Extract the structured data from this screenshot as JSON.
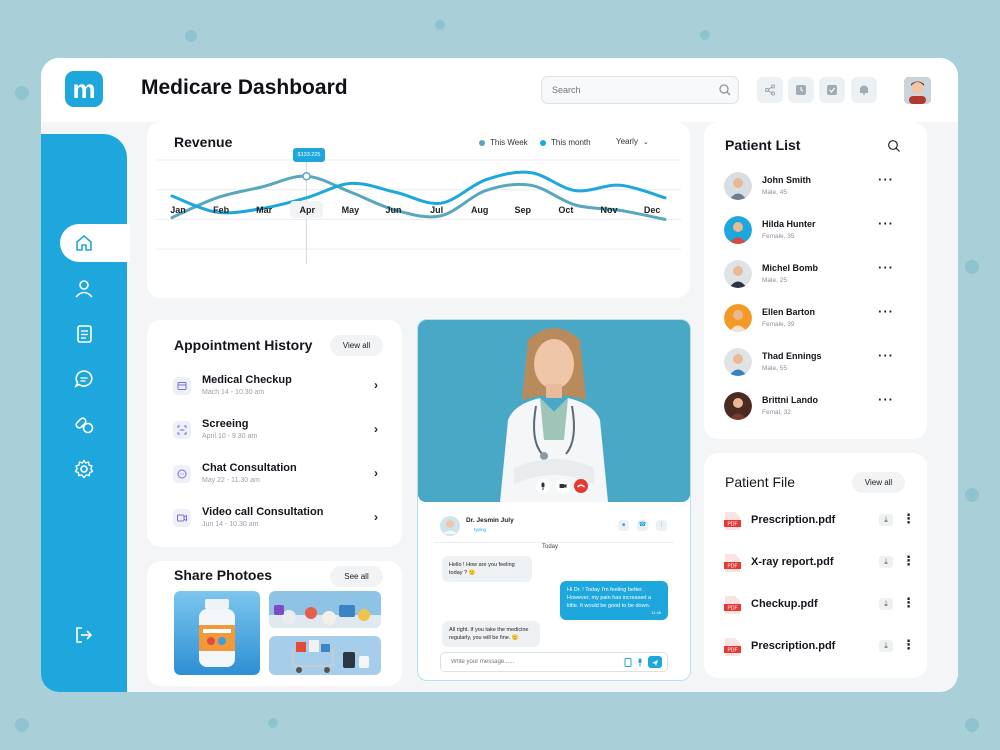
{
  "header": {
    "logo_letter": "m",
    "title": "Medicare Dashboard",
    "search_placeholder": "Search"
  },
  "revenue": {
    "title": "Revenue",
    "legend": [
      {
        "label": "This Week",
        "color": "#58a7bd"
      },
      {
        "label": "This month",
        "color": "#1ea7dd"
      }
    ],
    "period": "Yearly",
    "tooltip": "$133.225",
    "selected_month": "Apr"
  },
  "chart_data": {
    "type": "line",
    "categories": [
      "Jan",
      "Feb",
      "Mar",
      "Apr",
      "May",
      "Jun",
      "Jul",
      "Aug",
      "Sep",
      "Oct",
      "Nov",
      "Dec"
    ],
    "series": [
      {
        "name": "This Week",
        "color": "#58a7bd",
        "values": [
          36,
          58,
          70,
          82,
          64,
          44,
          38,
          66,
          72,
          50,
          44,
          34
        ]
      },
      {
        "name": "This month",
        "color": "#1ea7dd",
        "values": [
          60,
          42,
          46,
          58,
          74,
          64,
          52,
          78,
          86,
          66,
          72,
          58
        ]
      }
    ],
    "ylim": [
      0,
      100
    ],
    "grid": true
  },
  "appointments": {
    "title": "Appointment History",
    "view_all": "View all",
    "items": [
      {
        "name": "Medical Checkup",
        "date": "Mach 14 - 10.30 am"
      },
      {
        "name": "Screeing",
        "date": "April 10 - 9.30 am"
      },
      {
        "name": "Chat Consultation",
        "date": "May 22 - 11.30 am"
      },
      {
        "name": "Video call Consultation",
        "date": "Jun 14 - 10.30 am"
      }
    ]
  },
  "photos": {
    "title": "Share Photoes",
    "see_all": "See all"
  },
  "chat": {
    "doctor_name": "Dr. Jesmin July",
    "status": "typing",
    "day": "Today",
    "messages": [
      {
        "text": "Hello ! How are you feeling today ? 🙂",
        "from": "in"
      },
      {
        "text": "Hi Dr. ! Today I'm feeling better. However, my pain has increased a little. It would be good to be down.",
        "from": "out",
        "time": "11:45"
      },
      {
        "text": "All right. If you take the medicine regularly, you will be fine. 🙂",
        "from": "in"
      }
    ],
    "input_placeholder": "Write your message......"
  },
  "patients": {
    "title": "Patient List",
    "list": [
      {
        "name": "John Smith",
        "meta": "Male, 45",
        "avatar_bg": "#d8dde2",
        "shirt": "#6c7f8f"
      },
      {
        "name": "Hilda Hunter",
        "meta": "Female, 35",
        "avatar_bg": "#1ea7dd",
        "shirt": "#d64a3b"
      },
      {
        "name": "Michel Bomb",
        "meta": "Male, 25",
        "avatar_bg": "#dfe3e6",
        "shirt": "#2d3540"
      },
      {
        "name": "Ellen Barton",
        "meta": "Female, 39",
        "avatar_bg": "#f39a26",
        "shirt": "#f2e1d0"
      },
      {
        "name": "Thad Ennings",
        "meta": "Male, 55",
        "avatar_bg": "#dfe3e6",
        "shirt": "#3a7fc0"
      },
      {
        "name": "Brittni Lando",
        "meta": "Femal, 32",
        "avatar_bg": "#4b2a22",
        "shirt": "#7a3b2e"
      }
    ]
  },
  "files": {
    "title": "Patient File",
    "view_all": "View all",
    "list": [
      {
        "name": "Prescription.pdf"
      },
      {
        "name": "X-ray report.pdf"
      },
      {
        "name": "Checkup.pdf"
      },
      {
        "name": "Prescription.pdf"
      }
    ],
    "pdf_tag": "PDF"
  },
  "colors": {
    "accent": "#1ea7dd",
    "background": "#a9d0d9",
    "danger": "#e53935"
  }
}
